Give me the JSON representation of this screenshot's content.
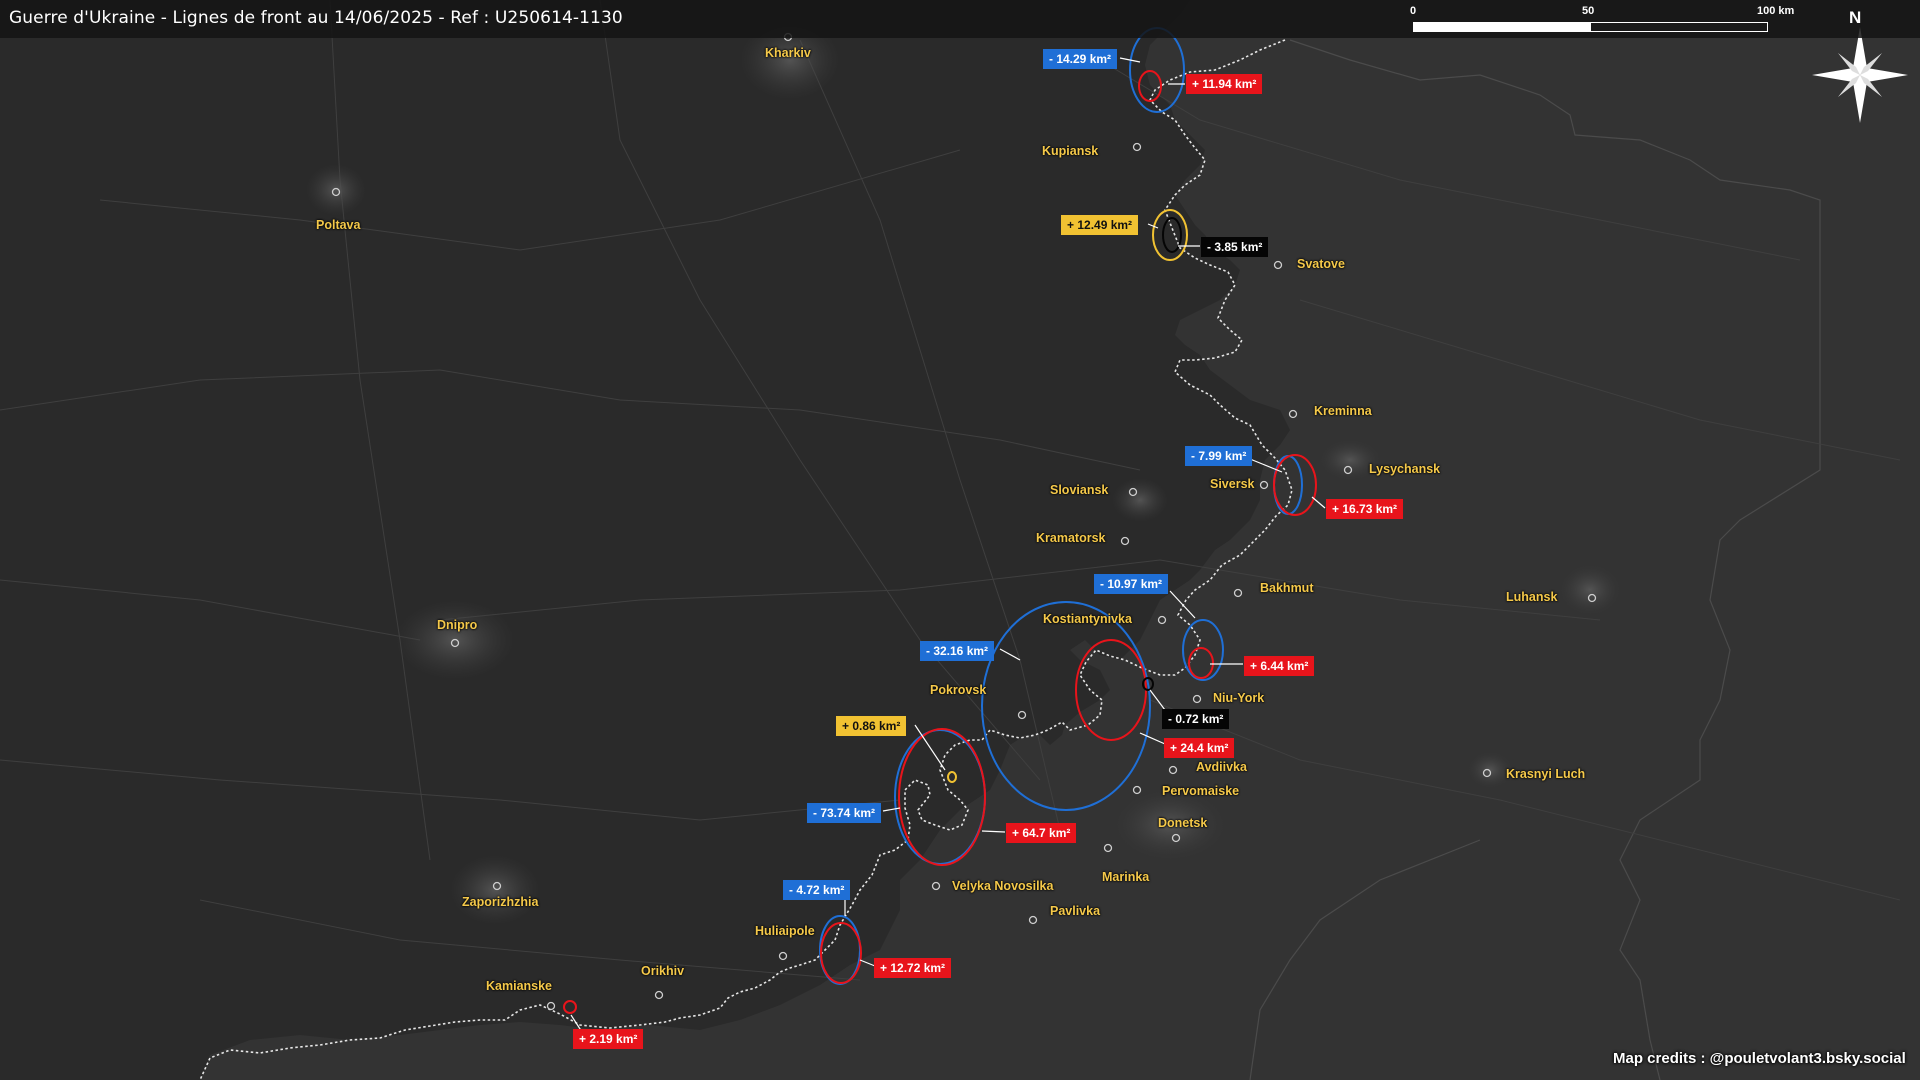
{
  "title": "Guerre d'Ukraine - Lignes de front au 14/06/2025 - Ref : U250614-1130",
  "scale": {
    "labels": [
      "0",
      "50",
      "100 km"
    ]
  },
  "north_label": "N",
  "credits": "Map credits : @pouletvolant3.bsky.social",
  "cities": [
    {
      "id": "kharkiv",
      "name": "Kharkiv"
    },
    {
      "id": "poltava",
      "name": "Poltava"
    },
    {
      "id": "kupiansk",
      "name": "Kupiansk"
    },
    {
      "id": "svatove",
      "name": "Svatove"
    },
    {
      "id": "kreminna",
      "name": "Kreminna"
    },
    {
      "id": "lysychansk",
      "name": "Lysychansk"
    },
    {
      "id": "siversk",
      "name": "Siversk"
    },
    {
      "id": "sloviansk",
      "name": "Sloviansk"
    },
    {
      "id": "kramatorsk",
      "name": "Kramatorsk"
    },
    {
      "id": "bakhmut",
      "name": "Bakhmut"
    },
    {
      "id": "luhansk",
      "name": "Luhansk"
    },
    {
      "id": "kostiantynivka",
      "name": "Kostiantynivka"
    },
    {
      "id": "dnipro",
      "name": "Dnipro"
    },
    {
      "id": "pokrovsk",
      "name": "Pokrovsk"
    },
    {
      "id": "niu-york",
      "name": "Niu-York"
    },
    {
      "id": "avdiivka",
      "name": "Avdiivka"
    },
    {
      "id": "pervomaiske",
      "name": "Pervomaiske"
    },
    {
      "id": "krasnyi-luch",
      "name": "Krasnyi Luch"
    },
    {
      "id": "donetsk",
      "name": "Donetsk"
    },
    {
      "id": "marinka",
      "name": "Marinka"
    },
    {
      "id": "velyka-novosilka",
      "name": "Velyka Novosilka"
    },
    {
      "id": "zaporizhzhia",
      "name": "Zaporizhzhia"
    },
    {
      "id": "pavlivka",
      "name": "Pavlivka"
    },
    {
      "id": "huliaipole",
      "name": "Huliaipole"
    },
    {
      "id": "orikhiv",
      "name": "Orikhiv"
    },
    {
      "id": "kamianske",
      "name": "Kamianske"
    }
  ],
  "changes": [
    {
      "id": "kupiansk-n-loss",
      "text": "- 14.29 km²",
      "color": "blue"
    },
    {
      "id": "kupiansk-n-gain",
      "text": "+ 11.94 km²",
      "color": "red"
    },
    {
      "id": "svatove-yellow",
      "text": "+ 12.49 km²",
      "color": "yellow"
    },
    {
      "id": "svatove-black",
      "text": "- 3.85 km²",
      "color": "black"
    },
    {
      "id": "siversk-loss",
      "text": "- 7.99 km²",
      "color": "blue"
    },
    {
      "id": "siversk-gain",
      "text": "+ 16.73 km²",
      "color": "red"
    },
    {
      "id": "bakhmut-loss",
      "text": "- 10.97 km²",
      "color": "blue"
    },
    {
      "id": "bakhmut-gain",
      "text": "+ 6.44 km²",
      "color": "red"
    },
    {
      "id": "pokrovsk-loss",
      "text": "- 32.16 km²",
      "color": "blue"
    },
    {
      "id": "niuyork-black",
      "text": "- 0.72 km²",
      "color": "black"
    },
    {
      "id": "pokrovsk-gain",
      "text": "+ 24.4 km²",
      "color": "red"
    },
    {
      "id": "vn-yellow",
      "text": "+ 0.86 km²",
      "color": "yellow"
    },
    {
      "id": "vn-loss",
      "text": "- 73.74 km²",
      "color": "blue"
    },
    {
      "id": "vn-gain",
      "text": "+ 64.7 km²",
      "color": "red"
    },
    {
      "id": "huliaipole-loss",
      "text": "- 4.72 km²",
      "color": "blue"
    },
    {
      "id": "huliaipole-gain",
      "text": "+ 12.72 km²",
      "color": "red"
    },
    {
      "id": "kamianske-gain",
      "text": "+ 2.19 km²",
      "color": "red"
    }
  ],
  "colors": {
    "background": "#2b2b2b",
    "occupied": "#3c3c3c",
    "city_label": "#f5c94a",
    "blue": "#1f6fd6",
    "red": "#e8141b",
    "yellow": "#f1c232",
    "frontline": "#e6e6e6"
  }
}
